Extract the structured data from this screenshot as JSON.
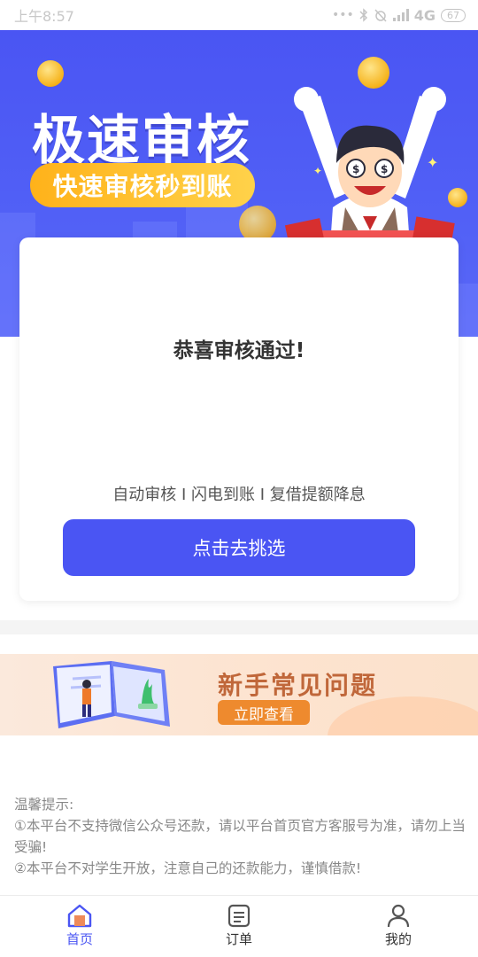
{
  "status_bar": {
    "time": "上午8:57",
    "network": "4G",
    "battery": "67"
  },
  "hero": {
    "title": "极速审核",
    "pill": "快速审核秒到账"
  },
  "card": {
    "title": "恭喜审核通过!",
    "features": "自动审核 I 闪电到账 I 复借提额降息",
    "button": "点击去挑选"
  },
  "faq_banner": {
    "title": "新手常见问题",
    "button": "立即查看"
  },
  "tips": {
    "heading": "温馨提示:",
    "line1": "①本平台不支持微信公众号还款，请以平台首页官方客服号为准，请勿上当受骗!",
    "line2": "②本平台不对学生开放，注意自己的还款能力，谨慎借款!"
  },
  "tab_bar": {
    "items": [
      {
        "label": "首页",
        "icon": "home-icon",
        "active": true
      },
      {
        "label": "订单",
        "icon": "order-icon",
        "active": false
      },
      {
        "label": "我的",
        "icon": "profile-icon",
        "active": false
      }
    ]
  },
  "colors": {
    "primary": "#4a55f3",
    "accent": "#ffb21a",
    "faq_title": "#c0673a",
    "faq_button": "#ee8a2e"
  }
}
